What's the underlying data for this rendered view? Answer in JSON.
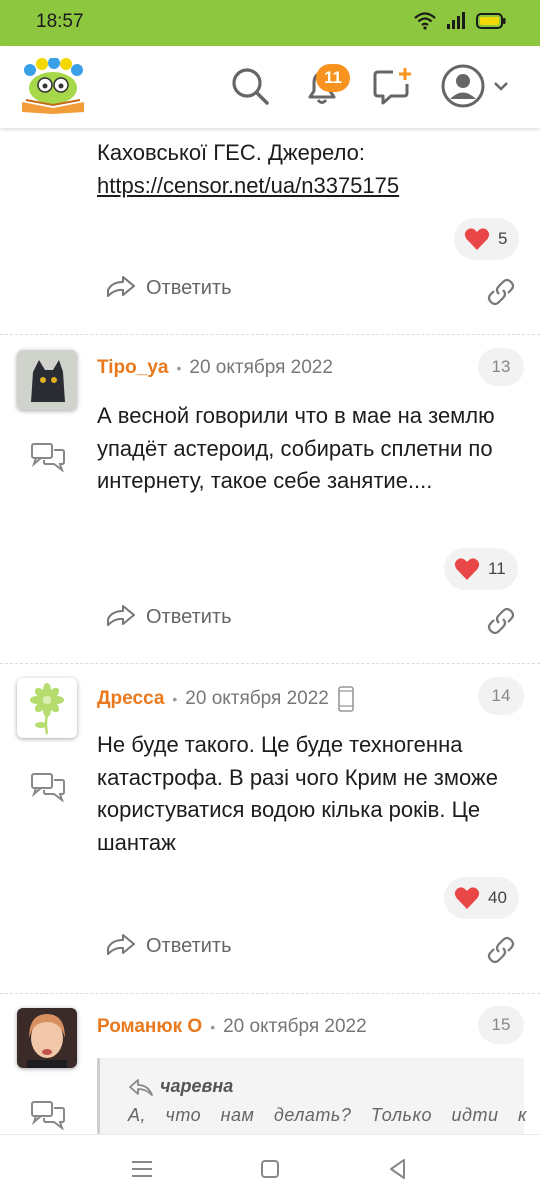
{
  "status_bar": {
    "time": "18:57"
  },
  "header": {
    "notification_count": "11"
  },
  "previous_post": {
    "text_line": "Каховської ГЕС. Джерело:",
    "link": "https://censor.net/ua/n3375175",
    "likes": "5",
    "reply_label": "Ответить"
  },
  "comments": [
    {
      "number": "13",
      "author": "Tipo_ya",
      "date": "20 октября 2022",
      "text": "А весной говорили что в мае на землю упадёт астероид, собирать сплетни по интернету, такое себе занятие....",
      "likes": "11",
      "reply_label": "Ответить"
    },
    {
      "number": "14",
      "author": "Дресса",
      "date": "20 октября 2022",
      "text": "Не буде такого. Це буде техногенна катастрофа. В разі чого Крим не зможе користуватися водою кілька років. Це шантаж",
      "likes": "40",
      "reply_label": "Ответить"
    },
    {
      "number": "15",
      "author": "Романюк О",
      "date": "20 октября 2022",
      "quote_author": "чаревна",
      "quote_text": "А, что нам делать? Только идти к"
    }
  ]
}
